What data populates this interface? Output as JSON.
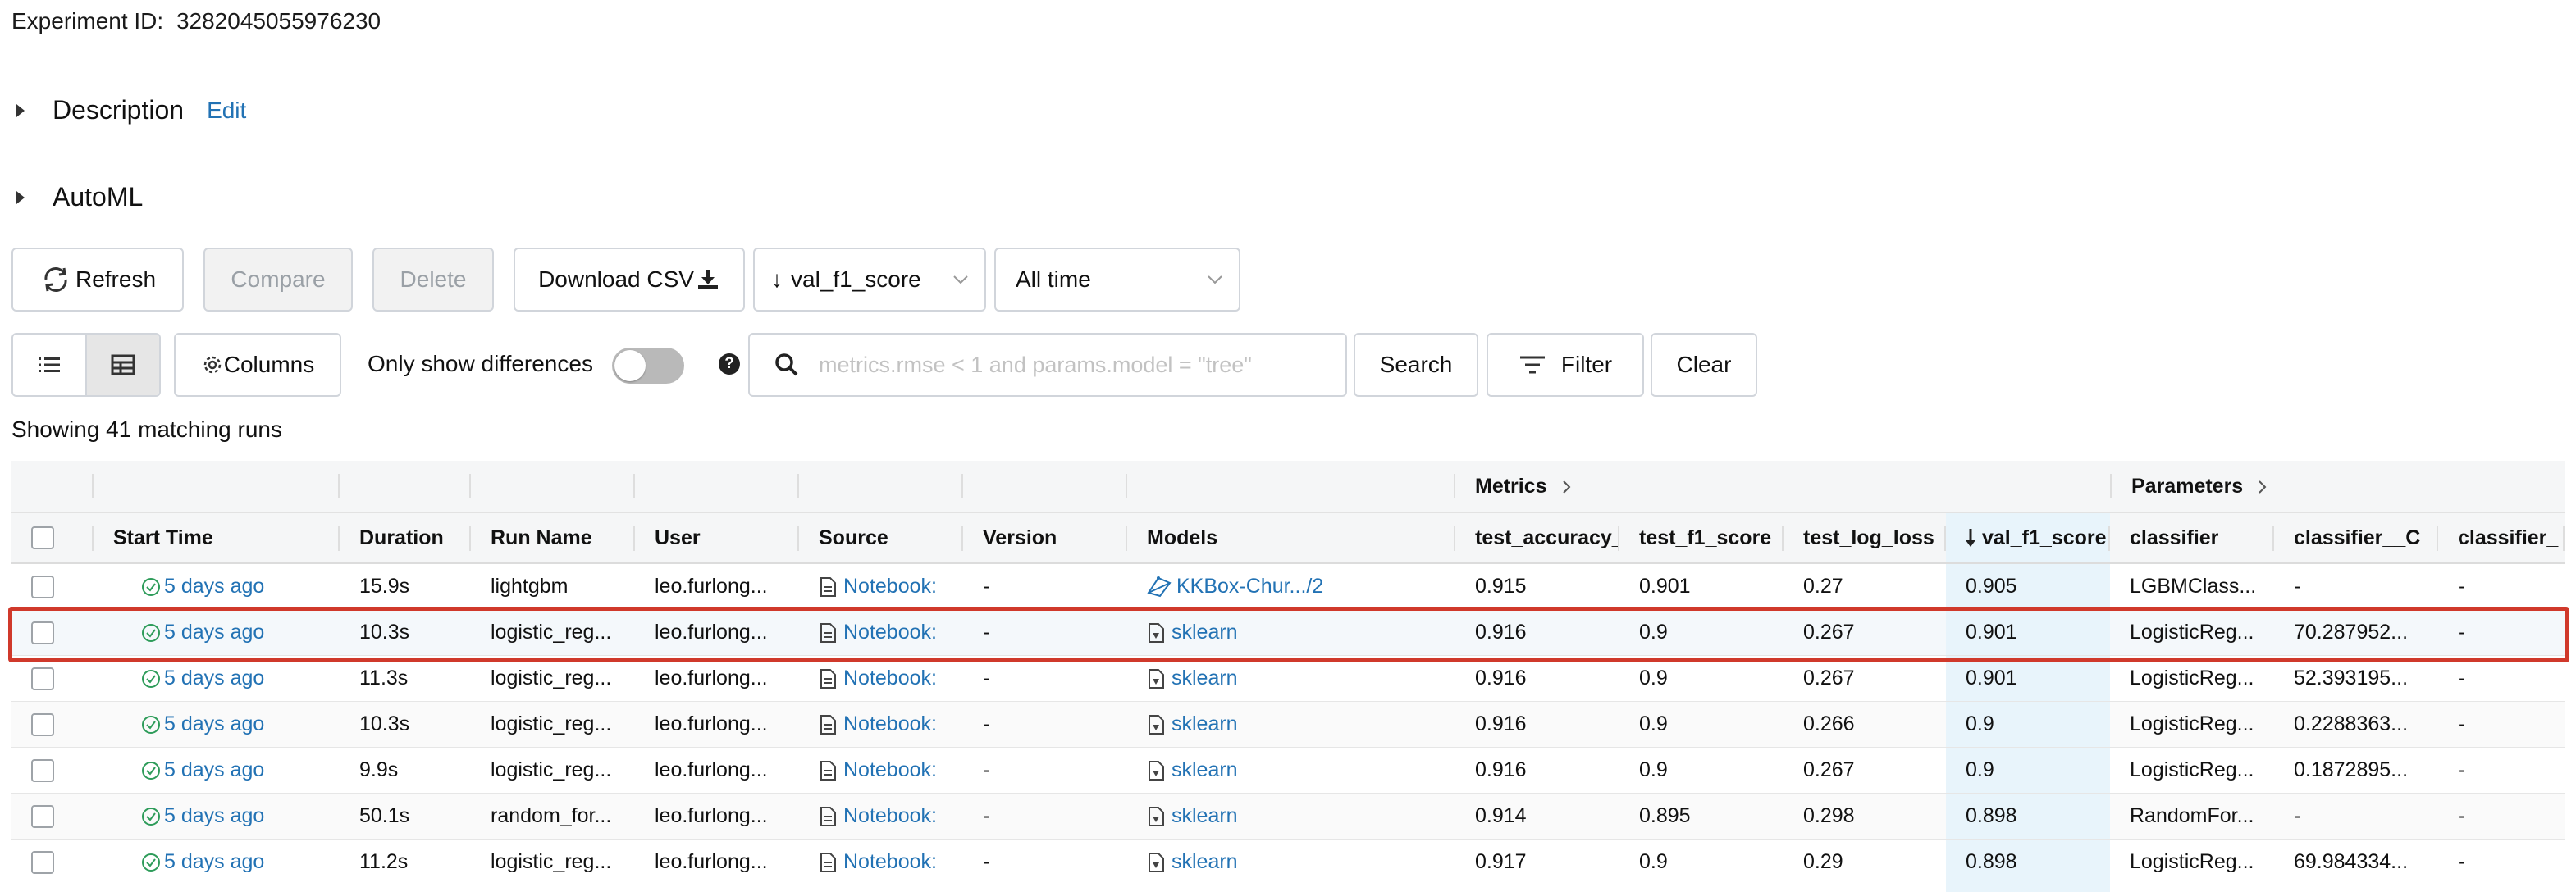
{
  "experiment": {
    "id_label": "Experiment ID:",
    "id_value": "3282045055976230"
  },
  "sections": {
    "description": "Description",
    "edit": "Edit",
    "automl": "AutoML"
  },
  "toolbar": {
    "refresh": "Refresh",
    "compare": "Compare",
    "delete": "Delete",
    "download_csv": "Download CSV",
    "sort_value": "val_f1_score",
    "time_value": "All time"
  },
  "filters": {
    "columns": "Columns",
    "only_show_differences": "Only show differences",
    "help": "?",
    "search_placeholder": "metrics.rmse < 1 and params.model = \"tree\"",
    "search": "Search",
    "filter": "Filter",
    "clear": "Clear"
  },
  "summary": "Showing 41 matching runs",
  "table": {
    "groups": {
      "metrics": "Metrics",
      "parameters": "Parameters"
    },
    "columns": [
      "Start Time",
      "Duration",
      "Run Name",
      "User",
      "Source",
      "Version",
      "Models",
      "test_accuracy_",
      "test_f1_score",
      "test_log_loss",
      "val_f1_score",
      "classifier",
      "classifier__C",
      "classifier_"
    ],
    "rows": [
      {
        "start": "5 days ago",
        "duration": "15.9s",
        "run_name": "lightgbm",
        "user": "leo.furlong...",
        "source": "Notebook:",
        "version": "-",
        "model": "KKBox-Chur.../2",
        "model_icon": "model-registry-icon",
        "acc": "0.915",
        "f1": "0.901",
        "logloss": "0.27",
        "val_f1": "0.905",
        "classifier": "LGBMClass...",
        "c": "-",
        "extra": "-"
      },
      {
        "start": "5 days ago",
        "duration": "10.3s",
        "run_name": "logistic_reg...",
        "user": "leo.furlong...",
        "source": "Notebook:",
        "version": "-",
        "model": "sklearn",
        "model_icon": "sklearn-icon",
        "acc": "0.916",
        "f1": "0.9",
        "logloss": "0.267",
        "val_f1": "0.901",
        "classifier": "LogisticReg...",
        "c": "70.287952...",
        "extra": "-"
      },
      {
        "start": "5 days ago",
        "duration": "11.3s",
        "run_name": "logistic_reg...",
        "user": "leo.furlong...",
        "source": "Notebook:",
        "version": "-",
        "model": "sklearn",
        "model_icon": "sklearn-icon",
        "acc": "0.916",
        "f1": "0.9",
        "logloss": "0.267",
        "val_f1": "0.901",
        "classifier": "LogisticReg...",
        "c": "52.393195...",
        "extra": "-"
      },
      {
        "start": "5 days ago",
        "duration": "10.3s",
        "run_name": "logistic_reg...",
        "user": "leo.furlong...",
        "source": "Notebook:",
        "version": "-",
        "model": "sklearn",
        "model_icon": "sklearn-icon",
        "acc": "0.916",
        "f1": "0.9",
        "logloss": "0.266",
        "val_f1": "0.9",
        "classifier": "LogisticReg...",
        "c": "0.2288363...",
        "extra": "-"
      },
      {
        "start": "5 days ago",
        "duration": "9.9s",
        "run_name": "logistic_reg...",
        "user": "leo.furlong...",
        "source": "Notebook:",
        "version": "-",
        "model": "sklearn",
        "model_icon": "sklearn-icon",
        "acc": "0.916",
        "f1": "0.9",
        "logloss": "0.267",
        "val_f1": "0.9",
        "classifier": "LogisticReg...",
        "c": "0.1872895...",
        "extra": "-"
      },
      {
        "start": "5 days ago",
        "duration": "50.1s",
        "run_name": "random_for...",
        "user": "leo.furlong...",
        "source": "Notebook:",
        "version": "-",
        "model": "sklearn",
        "model_icon": "sklearn-icon",
        "acc": "0.914",
        "f1": "0.895",
        "logloss": "0.298",
        "val_f1": "0.898",
        "classifier": "RandomFor...",
        "c": "-",
        "extra": "-"
      },
      {
        "start": "5 days ago",
        "duration": "11.2s",
        "run_name": "logistic_reg...",
        "user": "leo.furlong...",
        "source": "Notebook:",
        "version": "-",
        "model": "sklearn",
        "model_icon": "sklearn-icon",
        "acc": "0.917",
        "f1": "0.9",
        "logloss": "0.29",
        "val_f1": "0.898",
        "classifier": "LogisticReg...",
        "c": "69.984334...",
        "extra": "-"
      }
    ],
    "highlighted_row": 1
  },
  "colors": {
    "link": "#2272b4",
    "success": "#2e9c5a",
    "sort_column_bg": "#e8f4fb",
    "highlight_border": "#d0392b"
  }
}
